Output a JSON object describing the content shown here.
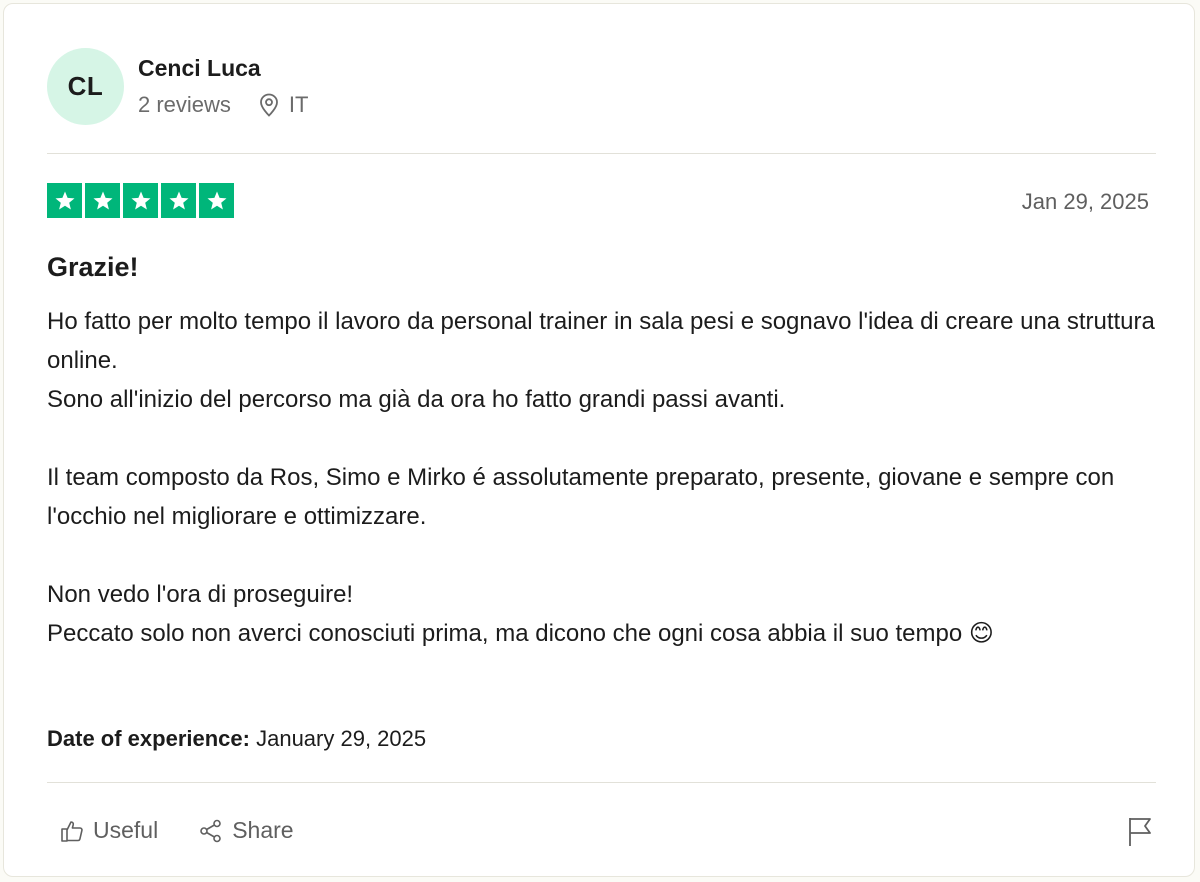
{
  "consumer": {
    "initials": "CL",
    "name": "Cenci Luca",
    "reviews": "2 reviews",
    "country": "IT",
    "avatar_color": "#d6f5e6"
  },
  "review": {
    "rating": 5,
    "star_color": "#00b67a",
    "date": "Jan 29, 2025",
    "title": "Grazie!",
    "paragraphs": [
      [
        "Ho fatto per molto tempo il lavoro da personal trainer in sala pesi e sognavo l'idea di creare una struttura online.",
        "Sono all'inizio del percorso ma già da ora ho fatto grandi passi avanti."
      ],
      [
        "Il team composto da Ros, Simo e Mirko é assolutamente preparato, presente, giovane e sempre con l'occhio nel migliorare e ottimizzare."
      ],
      [
        "Non vedo l'ora di proseguire!",
        "Peccato solo non averci conosciuti prima, ma dicono che ogni cosa abbia il suo tempo 😊"
      ]
    ],
    "experience_label": "Date of experience:",
    "experience_date": "January 29, 2025"
  },
  "actions": {
    "useful_label": "Useful",
    "share_label": "Share",
    "icons": [
      "thumbs-up-icon",
      "share-icon",
      "flag-icon"
    ]
  }
}
